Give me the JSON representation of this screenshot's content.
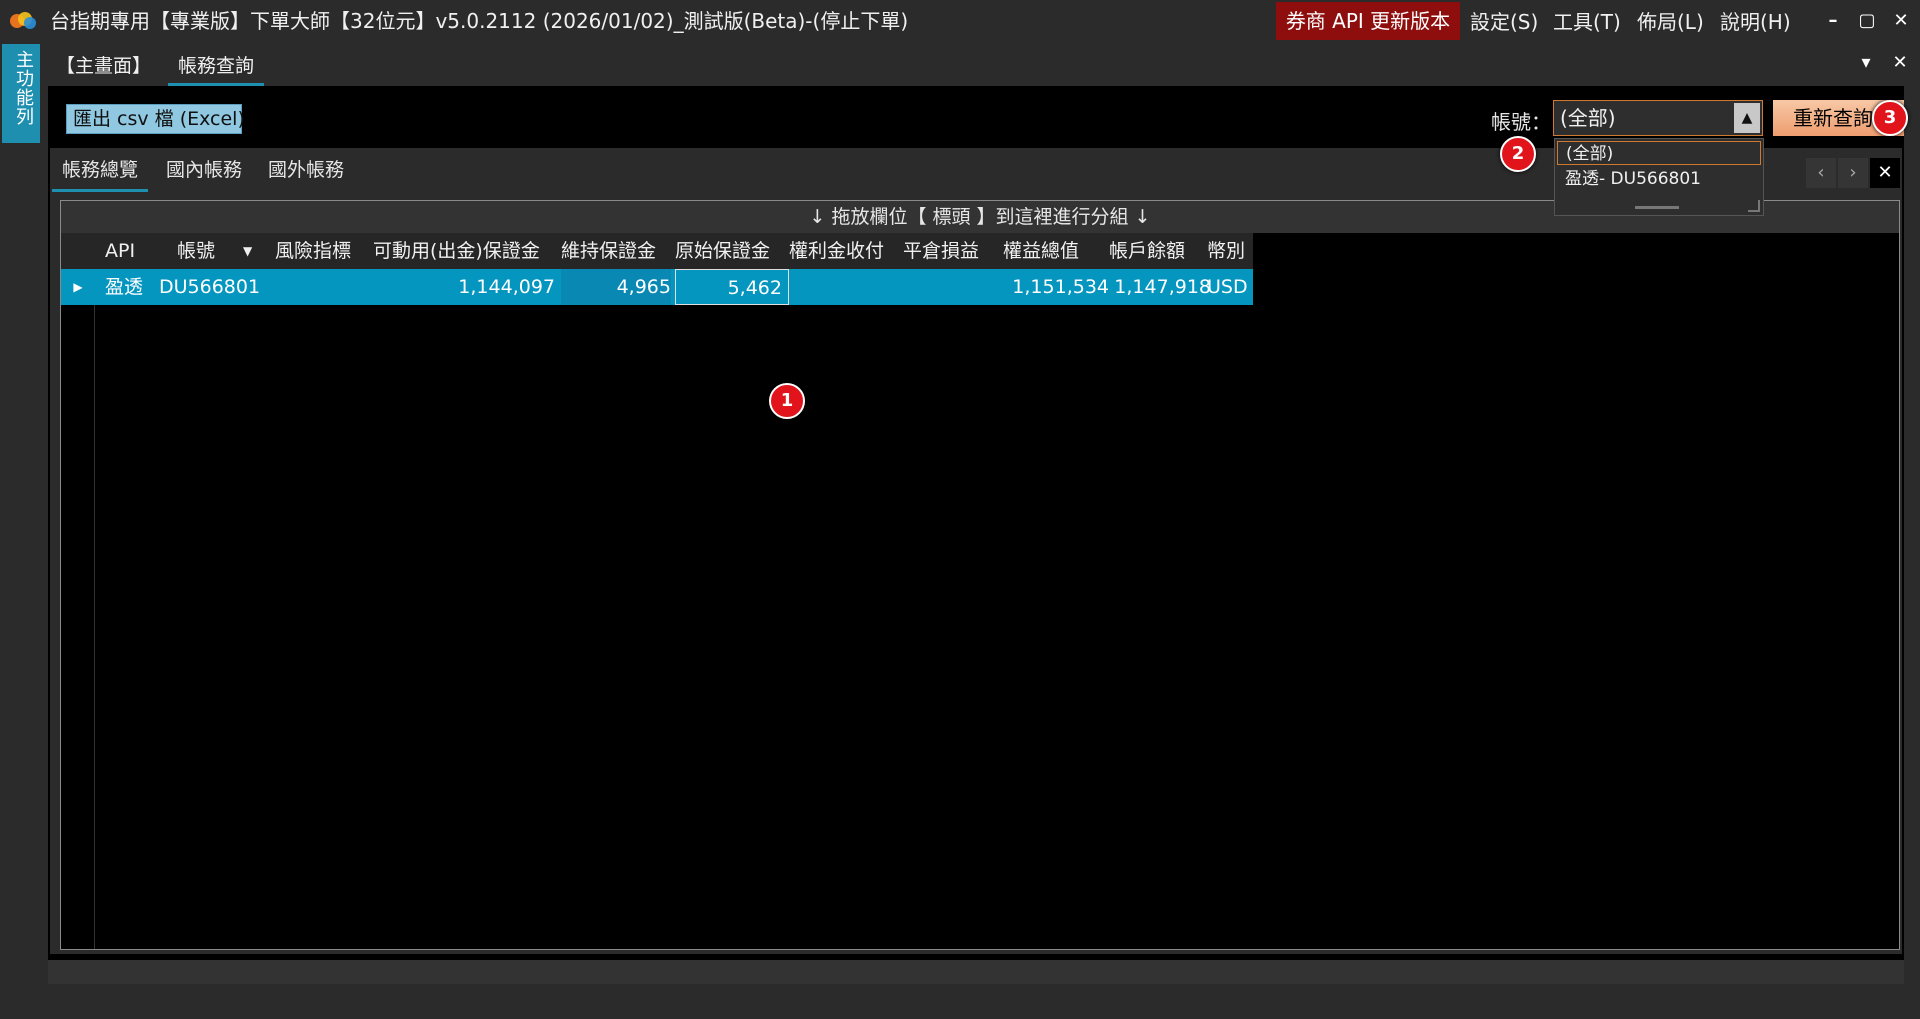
{
  "window": {
    "title": "台指期專用【專業版】下單大師【32位元】v5.0.2112  (2026/01/02)_測試版(Beta)-(停止下單)",
    "api_update_label": "券商 API 更新版本",
    "menus": [
      "設定(S)",
      "工具(T)",
      "佈局(L)",
      "說明(H)"
    ],
    "minimize": "–",
    "maximize": "▢",
    "close": "✕"
  },
  "side_strip": {
    "label": "主功能列"
  },
  "top_tabs": {
    "items": [
      "【主畫面】",
      "帳務查詢"
    ],
    "pin": "▾",
    "close": "✕"
  },
  "toolbar": {
    "export_label": "匯出 csv 檔 (Excel)",
    "account_label": "帳號：",
    "account_value": "(全部)",
    "requery_label": "重新查詢"
  },
  "dropdown": {
    "options": [
      "(全部)",
      "盈透- DU566801"
    ]
  },
  "sub_tabs": [
    "帳務總覽",
    "國內帳務",
    "國外帳務"
  ],
  "panel_nav": {
    "prev": "‹",
    "next": "›",
    "close": "✕"
  },
  "grid": {
    "group_hint": "↓ 拖放欄位【 標頭 】到這裡進行分組 ↓",
    "columns": [
      "API",
      "帳號",
      "風險指標",
      "可動用(出金)保證金",
      "維持保證金",
      "原始保證金",
      "權利金收付",
      "平倉損益",
      "權益總值",
      "帳戶餘額",
      "幣別"
    ],
    "rows": [
      [
        "盈透",
        "DU566801",
        "",
        "1,144,097",
        "4,965",
        "5,462",
        "",
        "",
        "1,151,534",
        "1,147,918",
        "USD"
      ]
    ]
  },
  "callouts": [
    "1",
    "2",
    "3"
  ],
  "colors": {
    "accent": "#1f8fb0",
    "row_selected": "#0596c0",
    "api_update_bg": "#8e0e0e",
    "requery_bg": "#ee9d6f",
    "callout": "#e0141a"
  }
}
